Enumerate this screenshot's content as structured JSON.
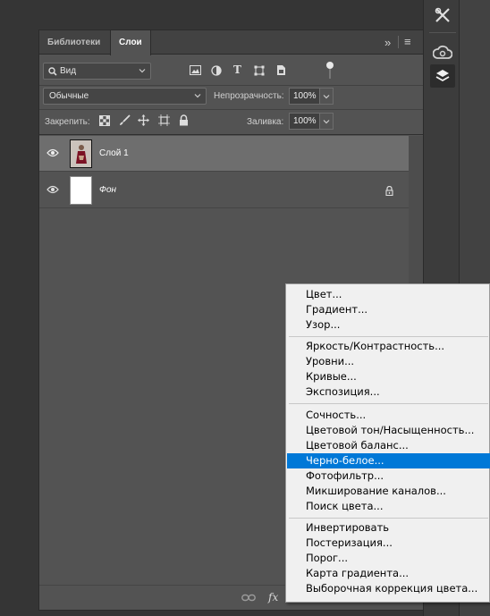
{
  "tabs": [
    {
      "label": "Библиотеки",
      "active": false
    },
    {
      "label": "Слои",
      "active": true
    }
  ],
  "panel_menu_glyph": "≡",
  "collapse_glyph": "»",
  "filter": {
    "kind_label": "Вид"
  },
  "blend": {
    "mode": "Обычные",
    "opacity_label": "Непрозрачность:",
    "opacity_value": "100%"
  },
  "lock": {
    "label": "Закрепить:",
    "fill_label": "Заливка:",
    "fill_value": "100%"
  },
  "layers": [
    {
      "name": "Слой 1",
      "selected": true,
      "italic": false,
      "locked": false
    },
    {
      "name": "Фон",
      "selected": false,
      "italic": true,
      "locked": true
    }
  ],
  "footer": {
    "fx_label": "fx"
  },
  "menu": {
    "groups": [
      [
        "Цвет...",
        "Градиент...",
        "Узор..."
      ],
      [
        "Яркость/Контрастность...",
        "Уровни...",
        "Кривые...",
        "Экспозиция..."
      ],
      [
        "Сочность...",
        "Цветовой тон/Насыщенность...",
        "Цветовой баланс...",
        "Черно-белое...",
        "Фотофильтр...",
        "Микширование каналов...",
        "Поиск цвета..."
      ],
      [
        "Инвертировать",
        "Постеризация...",
        "Порог...",
        "Карта градиента...",
        "Выборочная коррекция цвета..."
      ]
    ],
    "highlighted": "Черно-белое..."
  },
  "colors": {
    "accent": "#0078d7",
    "panel": "#535353",
    "selected_row": "#6e6e6e"
  },
  "icons": [
    "tools-icon",
    "creative-cloud-icon",
    "layers-icon",
    "eye-icon",
    "lock-icon",
    "link-icon"
  ]
}
